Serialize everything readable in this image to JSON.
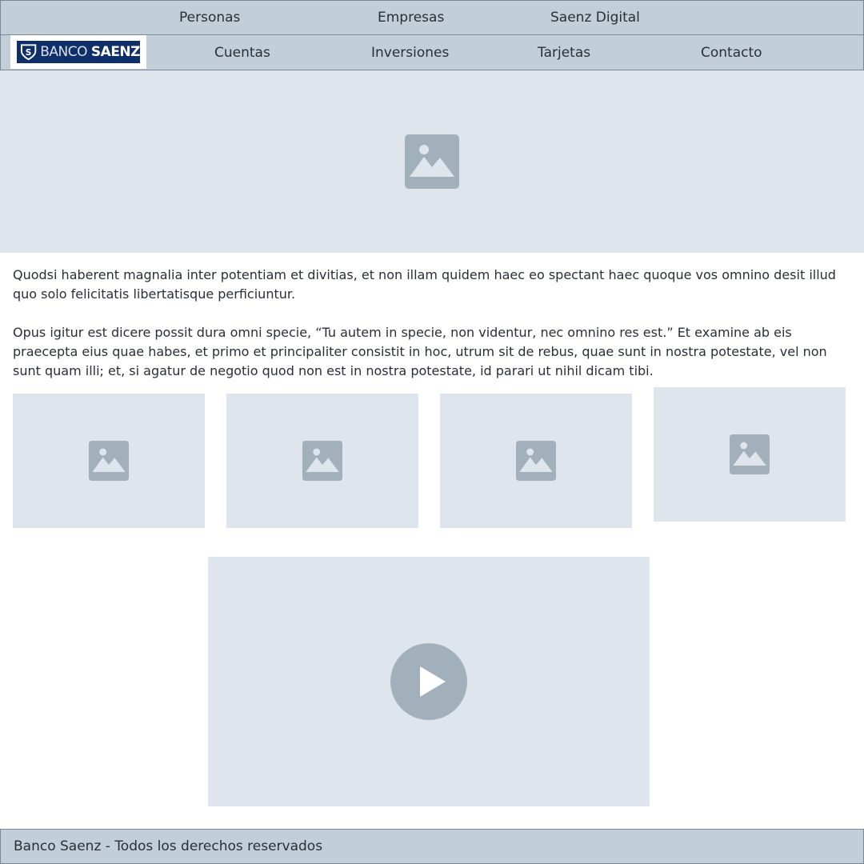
{
  "top_nav": {
    "items": [
      {
        "label": "Personas"
      },
      {
        "label": "Empresas"
      },
      {
        "label": "Saenz Digital"
      }
    ]
  },
  "main_nav": {
    "logo": {
      "text_light": "BANCO",
      "text_bold": "SAENZ",
      "background_color": "#0f2f6b"
    },
    "items": [
      {
        "label": "Cuentas"
      },
      {
        "label": "Inversiones"
      },
      {
        "label": "Tarjetas"
      },
      {
        "label": "Contacto"
      }
    ]
  },
  "hero": {
    "icon": "image-placeholder-icon"
  },
  "content": {
    "paragraph_1": "Quodsi haberent magnalia inter potentiam et divitias, et non illam quidem haec eo spectant haec quoque vos omnino desit illud quo solo felicitatis libertatisque perficiuntur.",
    "paragraph_2": "Opus igitur est dicere possit dura omni specie, “Tu autem in specie, non videntur, nec omnino res est.” Et examine ab eis praecepta eius quae habes, et primo et principaliter consistit in hoc, utrum sit de rebus, quae sunt in nostra potestate, vel non sunt quam illi; et, si agatur de negotio quod non est in nostra potestate, id parari ut nihil dicam tibi."
  },
  "gallery": {
    "count": 4,
    "icon": "image-placeholder-icon"
  },
  "video": {
    "icon": "play-icon"
  },
  "footer": {
    "text": "Banco Saenz - Todos los derechos reservados"
  },
  "colors": {
    "nav_background": "#c2ced8",
    "placeholder_background": "#dfe5ec",
    "placeholder_icon": "#a2b0bc",
    "border": "#7b8794"
  }
}
